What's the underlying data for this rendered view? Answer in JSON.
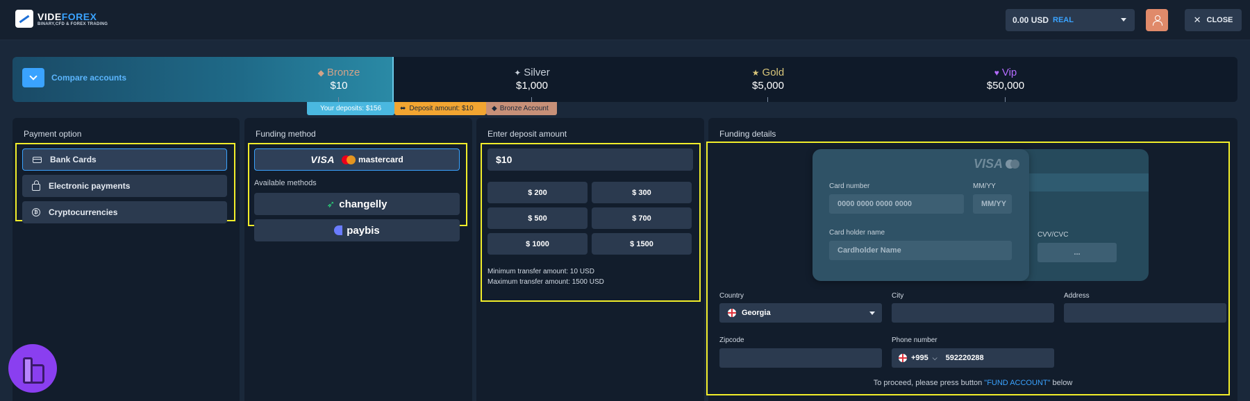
{
  "header": {
    "logo_prefix": "VIDE",
    "logo_suffix": "FOREX",
    "logo_tagline": "BINARY,CFD & FOREX TRADING",
    "balance": "0.00 USD",
    "account_type": "REAL",
    "close_label": "CLOSE"
  },
  "levels": {
    "compare_label": "Compare accounts",
    "tiers": [
      {
        "name": "Bronze",
        "amount": "$10"
      },
      {
        "name": "Silver",
        "amount": "$1,000"
      },
      {
        "name": "Gold",
        "amount": "$5,000"
      },
      {
        "name": "Vip",
        "amount": "$50,000"
      }
    ],
    "your_deposits": "Your deposits: $156",
    "deposit_amount": "Deposit amount: $10",
    "account_tag": "Bronze Account"
  },
  "payment": {
    "title": "Payment option",
    "options": [
      "Bank Cards",
      "Electronic payments",
      "Cryptocurrencies"
    ]
  },
  "funding": {
    "title": "Funding method",
    "main_visa": "VISA",
    "main_mc": "mastercard",
    "available_label": "Available methods",
    "alt_methods": [
      "changelly",
      "paybis"
    ]
  },
  "deposit": {
    "title": "Enter deposit amount",
    "value": "$10",
    "presets": [
      "$ 200",
      "$ 300",
      "$ 500",
      "$ 700",
      "$ 1000",
      "$ 1500"
    ],
    "min_text": "Minimum transfer amount: 10 USD",
    "max_text": "Maximum transfer amount: 1500 USD"
  },
  "details": {
    "title": "Funding details",
    "card_brand": "VISA",
    "card_number_label": "Card number",
    "card_number_placeholder": "0000 0000 0000 0000",
    "expiry_label": "MM/YY",
    "expiry_placeholder": "MM/YY",
    "holder_label": "Card holder name",
    "holder_placeholder": "Cardholder Name",
    "cvv_label": "CVV/CVC",
    "cvv_placeholder": "...",
    "country_label": "Country",
    "country_value": "Georgia",
    "city_label": "City",
    "address_label": "Address",
    "zip_label": "Zipcode",
    "phone_label": "Phone number",
    "phone_code": "+995",
    "phone_value": "592220288",
    "proceed_before": "To proceed, please press button ",
    "proceed_link": "\"FUND ACCOUNT\"",
    "proceed_after": " below"
  },
  "colors": {
    "accent": "#3aa3ff",
    "highlight": "#f2ee2a",
    "panel": "#121d2c",
    "field": "#2b3a4f"
  }
}
